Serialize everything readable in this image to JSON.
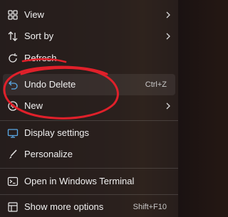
{
  "context_menu": {
    "items": [
      {
        "label": "View",
        "icon": "view-grid-icon",
        "has_submenu": true
      },
      {
        "label": "Sort by",
        "icon": "sort-icon",
        "has_submenu": true
      },
      {
        "label": "Refresh",
        "icon": "refresh-icon",
        "has_submenu": false
      },
      {
        "label": "Undo Delete",
        "icon": "undo-icon",
        "shortcut": "Ctrl+Z",
        "has_submenu": false
      },
      {
        "label": "New",
        "icon": "new-plus-icon",
        "has_submenu": true
      },
      {
        "label": "Display settings",
        "icon": "display-icon",
        "has_submenu": false
      },
      {
        "label": "Personalize",
        "icon": "personalize-brush-icon",
        "has_submenu": false
      },
      {
        "label": "Open in Windows Terminal",
        "icon": "terminal-icon",
        "has_submenu": false
      },
      {
        "label": "Show more options",
        "icon": "more-options-icon",
        "shortcut": "Shift+F10",
        "has_submenu": false
      }
    ]
  },
  "colors": {
    "menu_background": "#28201e",
    "text": "#f0f0f0",
    "accent_icon": "#5aa9e6",
    "annotation_red": "#e0202a"
  }
}
